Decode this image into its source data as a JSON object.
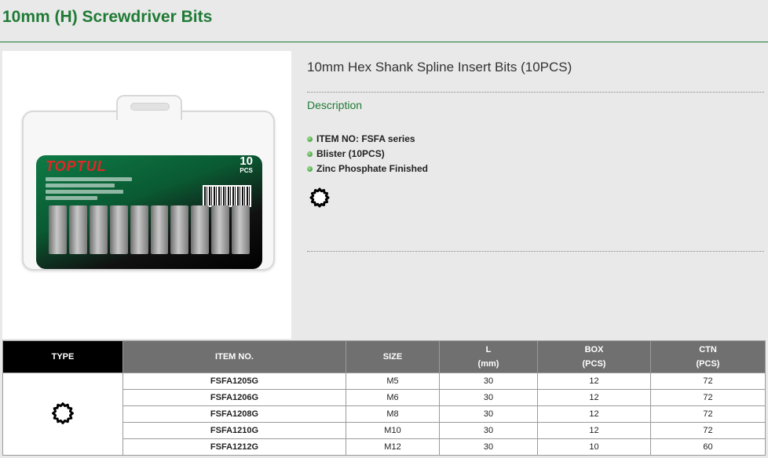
{
  "page": {
    "title": "10mm (H) Screwdriver Bits"
  },
  "product": {
    "name": "10mm Hex Shank Spline Insert Bits (10PCS)",
    "description_label": "Description",
    "features": [
      "ITEM NO: FSFA series",
      "Blister (10PCS)",
      "Zinc Phosphate Finished"
    ],
    "type_icon": "spline-12-point-icon",
    "package": {
      "brand": "TOPTUL",
      "count": "10",
      "count_unit": "PCS"
    }
  },
  "spec_table": {
    "columns": [
      {
        "line1": "TYPE",
        "line2": ""
      },
      {
        "line1": "ITEM NO.",
        "line2": ""
      },
      {
        "line1": "SIZE",
        "line2": ""
      },
      {
        "line1": "L",
        "line2": "(mm)"
      },
      {
        "line1": "BOX",
        "line2": "(PCS)"
      },
      {
        "line1": "CTN",
        "line2": "(PCS)"
      }
    ],
    "rows": [
      {
        "item": "FSFA1205G",
        "size": "M5",
        "l": "30",
        "box": "12",
        "ctn": "72"
      },
      {
        "item": "FSFA1206G",
        "size": "M6",
        "l": "30",
        "box": "12",
        "ctn": "72"
      },
      {
        "item": "FSFA1208G",
        "size": "M8",
        "l": "30",
        "box": "12",
        "ctn": "72"
      },
      {
        "item": "FSFA1210G",
        "size": "M10",
        "l": "30",
        "box": "12",
        "ctn": "72"
      },
      {
        "item": "FSFA1212G",
        "size": "M12",
        "l": "30",
        "box": "10",
        "ctn": "60"
      }
    ]
  },
  "colors": {
    "brand_green": "#1f7a35",
    "header_gray": "#707070",
    "type_header": "#000000"
  }
}
